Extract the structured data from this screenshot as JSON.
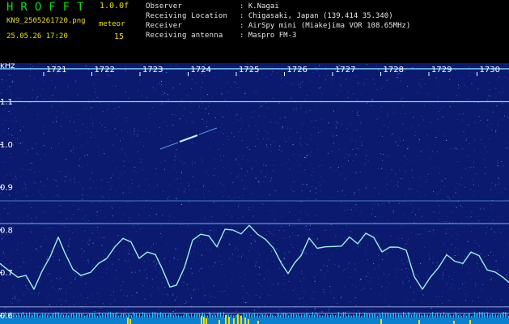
{
  "header": {
    "app_title": "HROFFT",
    "version": "1.0.0f",
    "filename": "KN9_2505261720.png",
    "datetime": "25.05.26 17:20",
    "meteor_label": "meteor",
    "meteor_count": "15",
    "info": [
      {
        "label": "Observer",
        "value": ": K.Nagai"
      },
      {
        "label": "Receiving Location",
        "value": ": Chigasaki, Japan (139.414 35.340)"
      },
      {
        "label": "Receiver",
        "value": ": AirSpy mini (Miakejima VOR 108.65MHz)"
      },
      {
        "label": "Receiving antenna",
        "value": ": Maspro FM-3"
      }
    ]
  },
  "spectrogram": {
    "unit": "kHz",
    "y_range": [
      0.58,
      1.19
    ],
    "y_ticks": [
      "1.1",
      "1.0",
      "0.9",
      "0.8",
      "0.7",
      "0.6"
    ],
    "time_labels": [
      "1721",
      "1722",
      "1723",
      "1724",
      "1725",
      "1726",
      "1727",
      "1728",
      "1729",
      "1730"
    ],
    "colors": {
      "background": "#0b1a6e",
      "trace": "#9ff0e0",
      "header_green": "#00e400",
      "header_yellow": "#e8e000",
      "label_white": "#ffffff"
    }
  }
}
